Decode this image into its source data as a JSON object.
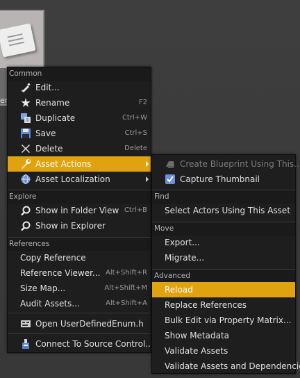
{
  "asset": {
    "label": "er"
  },
  "main_menu": {
    "sections": {
      "common": "Common",
      "explore": "Explore",
      "references": "References"
    },
    "items": {
      "edit": {
        "label": "Edit...",
        "icon": "pencil-icon"
      },
      "rename": {
        "label": "Rename",
        "shortcut": "F2",
        "icon": "rename-icon"
      },
      "duplicate": {
        "label": "Duplicate",
        "shortcut": "Ctrl+W",
        "icon": "duplicate-icon"
      },
      "save": {
        "label": "Save",
        "shortcut": "Ctrl+S",
        "icon": "save-icon"
      },
      "delete": {
        "label": "Delete",
        "shortcut": "Delete",
        "icon": "delete-icon"
      },
      "asset_actions": {
        "label": "Asset Actions",
        "icon": "wrench-icon"
      },
      "asset_localization": {
        "label": "Asset Localization",
        "icon": "globe-icon"
      },
      "show_folder_view": {
        "label": "Show in Folder View",
        "shortcut": "Ctrl+B",
        "icon": "magnifier-icon"
      },
      "show_explorer": {
        "label": "Show in Explorer",
        "icon": "magnifier-icon"
      },
      "copy_reference": {
        "label": "Copy Reference"
      },
      "reference_viewer": {
        "label": "Reference Viewer...",
        "shortcut": "Alt+Shift+R"
      },
      "size_map": {
        "label": "Size Map...",
        "shortcut": "Alt+Shift+M"
      },
      "audit_assets": {
        "label": "Audit Assets...",
        "shortcut": "Alt+Shift+A"
      },
      "open_header": {
        "label": "Open UserDefinedEnum.h",
        "icon": "code-file-icon"
      },
      "connect_source": {
        "label": "Connect To Source Control...",
        "icon": "source-control-icon"
      }
    }
  },
  "sub_menu": {
    "sections": {
      "find": "Find",
      "move": "Move",
      "advanced": "Advanced"
    },
    "items": {
      "create_blueprint": {
        "label": "Create Blueprint Using This...",
        "icon": "blueprint-icon",
        "disabled": true
      },
      "capture_thumbnail": {
        "label": "Capture Thumbnail",
        "icon": "checkbox-icon"
      },
      "select_actors": {
        "label": "Select Actors Using This Asset"
      },
      "export": {
        "label": "Export..."
      },
      "migrate": {
        "label": "Migrate..."
      },
      "reload": {
        "label": "Reload"
      },
      "replace_references": {
        "label": "Replace References"
      },
      "bulk_edit": {
        "label": "Bulk Edit via Property Matrix..."
      },
      "show_metadata": {
        "label": "Show Metadata"
      },
      "validate_assets": {
        "label": "Validate Assets"
      },
      "validate_deps": {
        "label": "Validate Assets and Dependencies"
      }
    }
  },
  "colors": {
    "highlight": "#e1a20f",
    "menu_bg": "#1e1e1e",
    "page_bg": "#3b3b3b"
  }
}
